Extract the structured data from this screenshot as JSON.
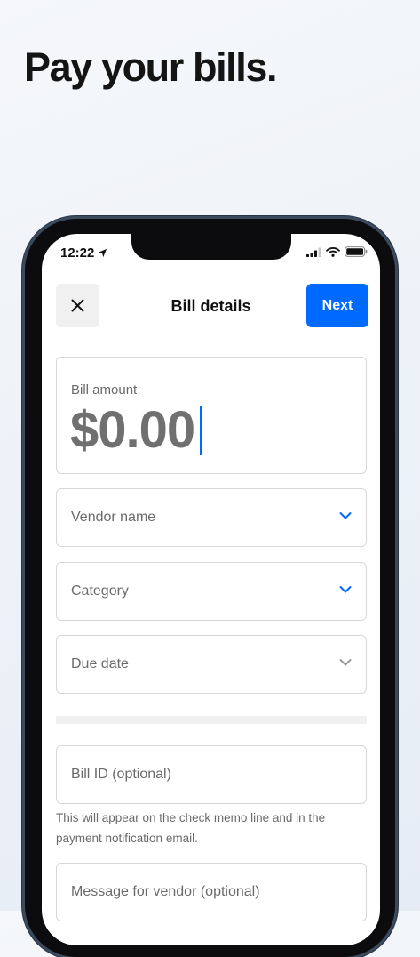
{
  "headline": "Pay your bills.",
  "status_bar": {
    "time": "12:22"
  },
  "header": {
    "title": "Bill details",
    "next_label": "Next"
  },
  "form": {
    "amount_label": "Bill amount",
    "amount_value": "$0.00",
    "vendor_placeholder": "Vendor name",
    "category_placeholder": "Category",
    "due_date_placeholder": "Due date",
    "bill_id_placeholder": "Bill ID (optional)",
    "bill_id_helper": "This will appear on the check memo line and in the payment notification email.",
    "message_placeholder": "Message for vendor (optional)"
  },
  "colors": {
    "accent": "#006aff",
    "chevron_active": "#006aff",
    "chevron_inactive": "#9a9a9a"
  },
  "icons": {
    "close": "close-icon",
    "location": "location-arrow-icon",
    "signal": "cellular-signal-icon",
    "wifi": "wifi-icon",
    "battery": "battery-icon",
    "chevron": "chevron-down-icon"
  }
}
